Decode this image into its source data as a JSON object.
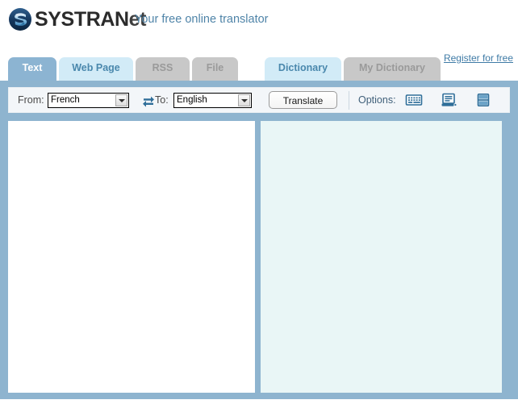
{
  "header": {
    "logo_icon": "systran-globe-icon",
    "logo_main": "SYSTRAN",
    "logo_suffix": "et",
    "tagline": "Your free online translator"
  },
  "tabs": {
    "left_group": [
      {
        "id": "tab-text",
        "label": "Text",
        "state": "active"
      },
      {
        "id": "tab-web-page",
        "label": "Web Page",
        "state": "light"
      },
      {
        "id": "tab-rss",
        "label": "RSS",
        "state": "grey"
      },
      {
        "id": "tab-file",
        "label": "File",
        "state": "grey"
      }
    ],
    "right_group": [
      {
        "id": "tab-dictionary",
        "label": "Dictionary",
        "state": "light"
      },
      {
        "id": "tab-my-dictionary",
        "label": "My Dictionary",
        "state": "grey"
      }
    ],
    "register_link": "Register for free"
  },
  "toolbar": {
    "from_label": "From:",
    "from_value": "French",
    "from_options": [
      "French"
    ],
    "swap_icon": "swap-arrows-icon",
    "to_label": "To:",
    "to_value": "English",
    "to_options": [
      "English"
    ],
    "translate_label": "Translate",
    "options_label": "Options:",
    "option_icons": [
      {
        "id": "virtual-keyboard-icon",
        "name": "virtual-keyboard-icon"
      },
      {
        "id": "display-options-icon",
        "name": "display-options-icon"
      },
      {
        "id": "layout-split-icon",
        "name": "layout-split-icon"
      }
    ]
  },
  "panels": {
    "source_text": "",
    "source_placeholder": "",
    "target_text": "",
    "target_placeholder": ""
  },
  "colors": {
    "frame_blue": "#8eb4cf",
    "tab_active": "#8cb4d2",
    "tab_light": "#d2ebf7",
    "tab_grey": "#c8c8c8",
    "tagline_blue": "#4f84a8",
    "link_blue": "#3f7ba6",
    "target_panel": "#e9f6f6",
    "icon_blue": "#336e96"
  }
}
